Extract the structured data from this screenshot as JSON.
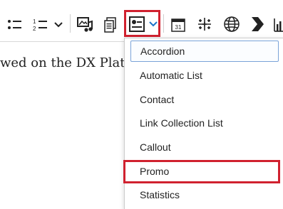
{
  "toolbar": {
    "buttons": [
      {
        "name": "bulleted-list-button",
        "icon": "bulleted-list-icon"
      },
      {
        "name": "numbered-list-button",
        "icon": "numbered-list-icon"
      },
      {
        "name": "list-style-dropdown-button",
        "icon": "chevron-down-icon"
      },
      {
        "name": "insert-media-button",
        "icon": "image-music-icon"
      },
      {
        "name": "insert-document-button",
        "icon": "document-icon"
      },
      {
        "name": "insert-component-button",
        "icon": "component-card-icon",
        "active": true
      },
      {
        "name": "insert-component-dropdown-button",
        "icon": "chevron-down-icon"
      },
      {
        "name": "insert-date-button",
        "icon": "calendar-icon"
      },
      {
        "name": "insert-tableau-button",
        "icon": "tableau-icon"
      },
      {
        "name": "insert-globe-button",
        "icon": "globe-icon"
      },
      {
        "name": "insert-arrow-button",
        "icon": "chevron-arrow-icon"
      },
      {
        "name": "insert-chart-button",
        "icon": "bar-chart-icon"
      }
    ],
    "calendar_number": "31"
  },
  "editor": {
    "text_fragment": "wed on the DX Platf"
  },
  "dropdown": {
    "items": [
      {
        "label": "Accordion",
        "focused": true
      },
      {
        "label": "Automatic List"
      },
      {
        "label": "Contact"
      },
      {
        "label": "Link Collection List"
      },
      {
        "label": "Callout"
      },
      {
        "label": "Promo",
        "highlighted": true
      },
      {
        "label": "Statistics"
      }
    ]
  },
  "colors": {
    "highlight": "#d0212f",
    "accent": "#1a73c9",
    "focus_border": "#7aa3d8"
  }
}
